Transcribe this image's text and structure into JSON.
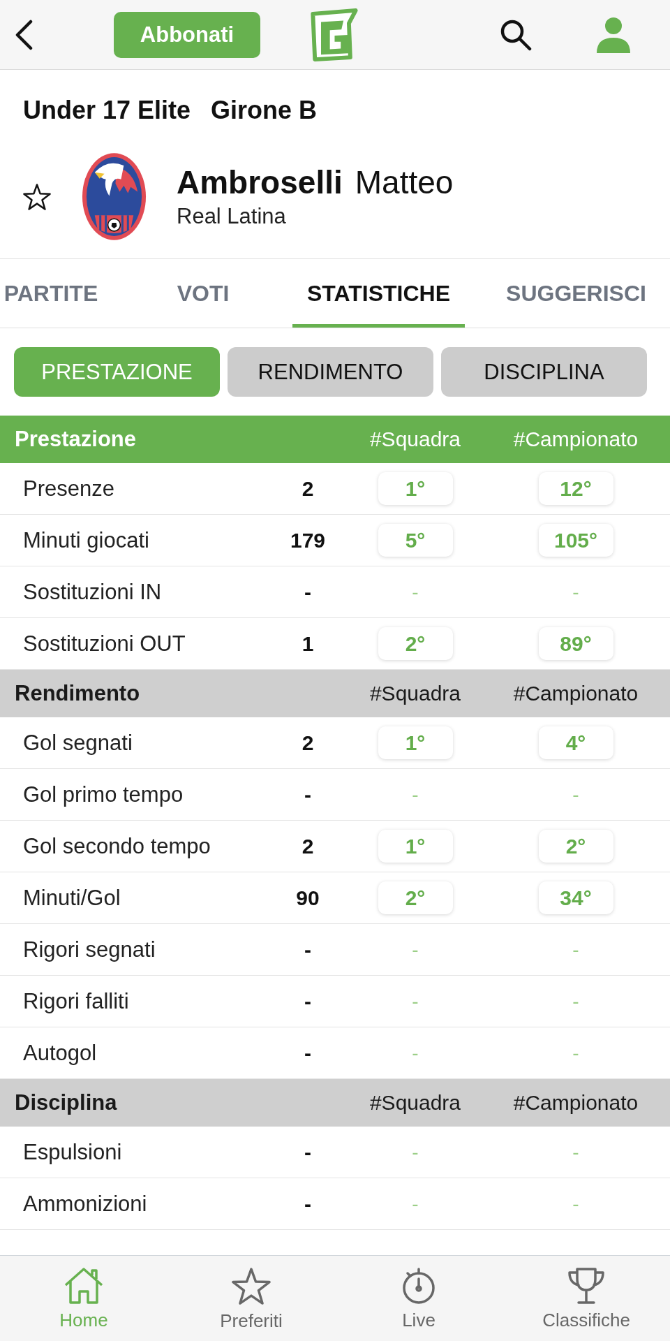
{
  "header": {
    "subscribe_button": "Abbonati"
  },
  "competition": {
    "name": "Under 17 Elite",
    "group": "Girone B"
  },
  "player": {
    "surname": "Ambroselli",
    "first_name": "Matteo",
    "team": "Real Latina",
    "favorite": false
  },
  "tabs": [
    {
      "label": "PARTITE",
      "selected": false
    },
    {
      "label": "VOTI",
      "selected": false
    },
    {
      "label": "STATISTICHE",
      "selected": true
    },
    {
      "label": "SUGGERISCI",
      "selected": false
    }
  ],
  "sub_tabs": [
    {
      "label": "PRESTAZIONE",
      "selected": true
    },
    {
      "label": "RENDIMENTO",
      "selected": false
    },
    {
      "label": "DISCIPLINA",
      "selected": false
    }
  ],
  "sections": [
    {
      "title": "Prestazione",
      "highlighted": true,
      "columns": [
        "#Squadra",
        "#Campionato"
      ],
      "rows": [
        {
          "label": "Presenze",
          "value": "2",
          "ranked": true,
          "team_rank": "1°",
          "league_rank": "12°"
        },
        {
          "label": "Minuti giocati",
          "value": "179",
          "ranked": true,
          "team_rank": "5°",
          "league_rank": "105°"
        },
        {
          "label": "Sostituzioni IN",
          "value": "-",
          "ranked": false,
          "team_rank": "-",
          "league_rank": "-"
        },
        {
          "label": "Sostituzioni OUT",
          "value": "1",
          "ranked": true,
          "team_rank": "2°",
          "league_rank": "89°"
        }
      ]
    },
    {
      "title": "Rendimento",
      "highlighted": false,
      "columns": [
        "#Squadra",
        "#Campionato"
      ],
      "rows": [
        {
          "label": "Gol segnati",
          "value": "2",
          "ranked": true,
          "team_rank": "1°",
          "league_rank": "4°"
        },
        {
          "label": "Gol primo tempo",
          "value": "-",
          "ranked": false,
          "team_rank": "-",
          "league_rank": "-"
        },
        {
          "label": "Gol secondo tempo",
          "value": "2",
          "ranked": true,
          "team_rank": "1°",
          "league_rank": "2°"
        },
        {
          "label": "Minuti/Gol",
          "value": "90",
          "ranked": true,
          "team_rank": "2°",
          "league_rank": "34°"
        },
        {
          "label": "Rigori segnati",
          "value": "-",
          "ranked": false,
          "team_rank": "-",
          "league_rank": "-"
        },
        {
          "label": "Rigori falliti",
          "value": "-",
          "ranked": false,
          "team_rank": "-",
          "league_rank": "-"
        },
        {
          "label": "Autogol",
          "value": "-",
          "ranked": false,
          "team_rank": "-",
          "league_rank": "-"
        }
      ]
    },
    {
      "title": "Disciplina",
      "highlighted": false,
      "columns": [
        "#Squadra",
        "#Campionato"
      ],
      "rows": [
        {
          "label": "Espulsioni",
          "value": "-",
          "ranked": false,
          "team_rank": "-",
          "league_rank": "-"
        },
        {
          "label": "Ammonizioni",
          "value": "-",
          "ranked": false,
          "team_rank": "-",
          "league_rank": "-"
        }
      ]
    }
  ],
  "bottom_nav": [
    {
      "label": "Home",
      "kind": "home",
      "selected": true
    },
    {
      "label": "Preferiti",
      "kind": "star",
      "selected": false
    },
    {
      "label": "Live",
      "kind": "timer",
      "selected": false
    },
    {
      "label": "Classifiche",
      "kind": "trophy",
      "selected": false
    }
  ]
}
